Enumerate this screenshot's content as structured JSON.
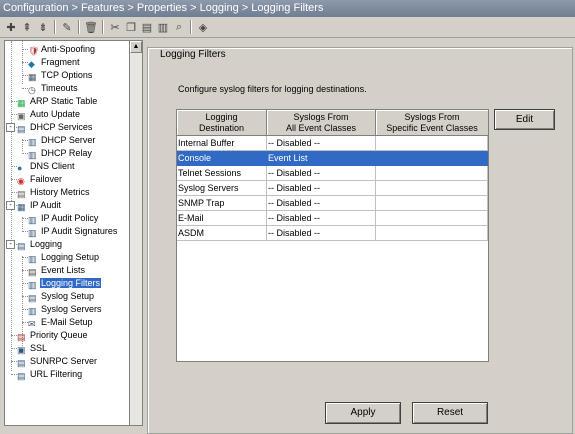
{
  "titlebar": {
    "breadcrumb": "Configuration > Features > Properties > Logging > Logging Filters"
  },
  "toolbar": {
    "icons": [
      "add-icon",
      "insert-above-icon",
      "insert-below-icon",
      "edit-icon",
      "delete-icon",
      "cut-icon",
      "copy-icon",
      "paste-icon",
      "paste-after-icon",
      "find-icon",
      "packet-trace-icon"
    ]
  },
  "tree": {
    "items": [
      {
        "label": "Anti-Spoofing",
        "icon": "shield-icon"
      },
      {
        "label": "Fragment",
        "icon": "fragment-icon"
      },
      {
        "label": "TCP Options",
        "icon": "tcp-options-icon"
      },
      {
        "label": "Timeouts",
        "icon": "clock-icon"
      },
      {
        "label": "ARP Static Table",
        "icon": "arp-table-icon"
      },
      {
        "label": "Auto Update",
        "icon": "auto-update-icon"
      },
      {
        "label": "DHCP Services",
        "icon": "dhcp-icon"
      },
      {
        "label": "DHCP Server",
        "icon": "dhcp-server-icon"
      },
      {
        "label": "DHCP Relay",
        "icon": "dhcp-relay-icon"
      },
      {
        "label": "DNS Client",
        "icon": "dns-icon"
      },
      {
        "label": "Failover",
        "icon": "failover-icon"
      },
      {
        "label": "History Metrics",
        "icon": "history-icon"
      },
      {
        "label": "IP Audit",
        "icon": "ip-audit-icon"
      },
      {
        "label": "IP Audit Policy",
        "icon": "policy-icon"
      },
      {
        "label": "IP Audit Signatures",
        "icon": "signature-icon"
      },
      {
        "label": "Logging",
        "icon": "logging-icon"
      },
      {
        "label": "Logging Setup",
        "icon": "logging-setup-icon"
      },
      {
        "label": "Event Lists",
        "icon": "event-list-icon"
      },
      {
        "label": "Logging Filters",
        "icon": "logging-filter-icon"
      },
      {
        "label": "Syslog Setup",
        "icon": "syslog-setup-icon"
      },
      {
        "label": "Syslog Servers",
        "icon": "syslog-server-icon"
      },
      {
        "label": "E-Mail Setup",
        "icon": "email-icon"
      },
      {
        "label": "Priority Queue",
        "icon": "queue-icon"
      },
      {
        "label": "SSL",
        "icon": "ssl-icon"
      },
      {
        "label": "SUNRPC Server",
        "icon": "sunrpc-icon"
      },
      {
        "label": "URL Filtering",
        "icon": "url-filter-icon"
      }
    ],
    "selected": "Logging Filters"
  },
  "panel": {
    "group_title": "Logging Filters",
    "description": "Configure syslog filters for logging destinations.",
    "table": {
      "headers": [
        [
          "Logging",
          "Destination"
        ],
        [
          "Syslogs From",
          "All Event Classes"
        ],
        [
          "Syslogs From",
          "Specific Event Classes"
        ]
      ],
      "rows": [
        [
          "Internal Buffer",
          "-- Disabled --",
          ""
        ],
        [
          "Console",
          "Event List",
          ""
        ],
        [
          "Telnet Sessions",
          "-- Disabled --",
          ""
        ],
        [
          "Syslog Servers",
          "-- Disabled --",
          ""
        ],
        [
          "SNMP Trap",
          "-- Disabled --",
          ""
        ],
        [
          "E-Mail",
          "-- Disabled --",
          ""
        ],
        [
          "ASDM",
          "-- Disabled --",
          ""
        ]
      ],
      "selected_row": 1
    },
    "edit_label": "Edit",
    "apply_label": "Apply",
    "reset_label": "Reset"
  },
  "colors": {
    "selection": "#316ac5",
    "background": "#d4d0c8",
    "titlebar": "#7a879b"
  }
}
